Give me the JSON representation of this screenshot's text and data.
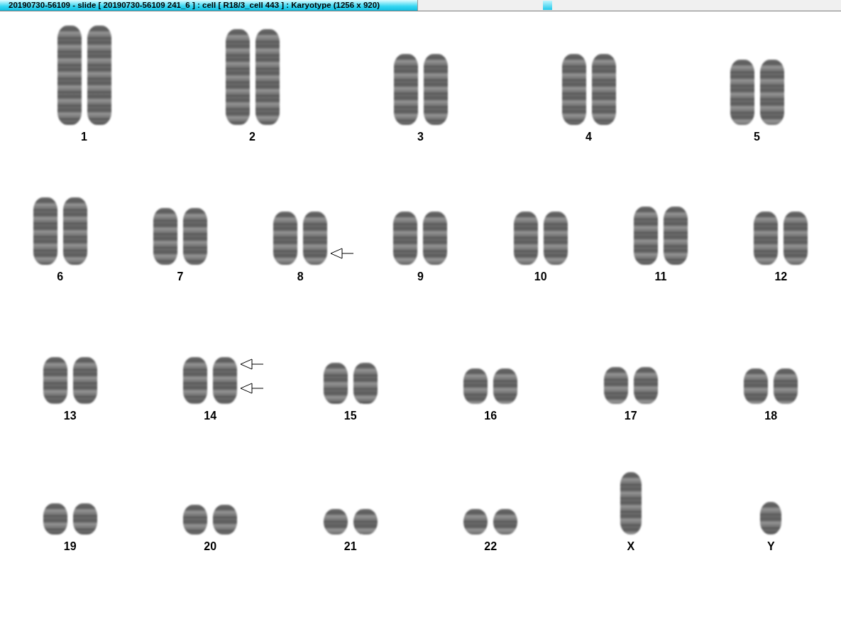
{
  "window": {
    "title": "20190730-56109 - slide [ 20190730-56109 241_6 ] : cell [ R18/3_cell 443 ] : Karyotype  (1256 x 920)"
  },
  "karyotype": {
    "rows": [
      {
        "items": [
          {
            "label": "1",
            "kind": "pair"
          },
          {
            "label": "2",
            "kind": "pair"
          },
          {
            "label": "3",
            "kind": "pair"
          },
          {
            "label": "4",
            "kind": "pair"
          },
          {
            "label": "5",
            "kind": "pair"
          }
        ]
      },
      {
        "items": [
          {
            "label": "6",
            "kind": "pair"
          },
          {
            "label": "7",
            "kind": "pair"
          },
          {
            "label": "8",
            "kind": "pair",
            "arrows": [
              {
                "kind": "lower"
              }
            ]
          },
          {
            "label": "9",
            "kind": "pair"
          },
          {
            "label": "10",
            "kind": "pair"
          },
          {
            "label": "11",
            "kind": "pair"
          },
          {
            "label": "12",
            "kind": "pair"
          }
        ]
      },
      {
        "items": [
          {
            "label": "13",
            "kind": "pair"
          },
          {
            "label": "14",
            "kind": "pair",
            "arrows": [
              {
                "kind": "upper"
              },
              {
                "kind": "middle"
              }
            ]
          },
          {
            "label": "15",
            "kind": "pair"
          },
          {
            "label": "16",
            "kind": "pair"
          },
          {
            "label": "17",
            "kind": "pair"
          },
          {
            "label": "18",
            "kind": "pair"
          }
        ]
      },
      {
        "items": [
          {
            "label": "19",
            "kind": "pair"
          },
          {
            "label": "20",
            "kind": "pair"
          },
          {
            "label": "21",
            "kind": "pair"
          },
          {
            "label": "22",
            "kind": "pair"
          },
          {
            "label": "X",
            "kind": "single"
          },
          {
            "label": "Y",
            "kind": "single"
          }
        ]
      }
    ]
  }
}
